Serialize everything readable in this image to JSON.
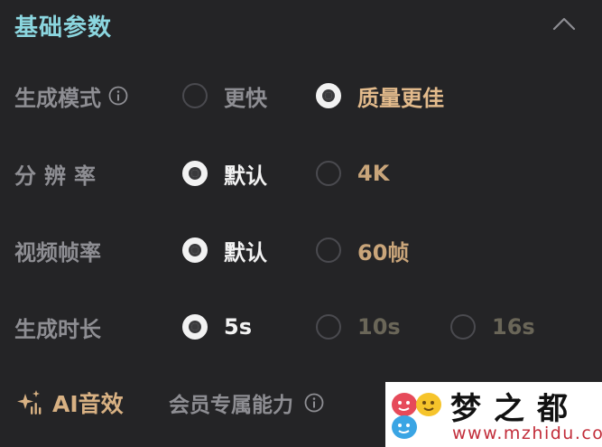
{
  "section": {
    "title": "基础参数",
    "collapse_icon": "chevron-up-icon"
  },
  "rows": [
    {
      "label": "生成模式",
      "info_icon": "info-icon",
      "options": [
        {
          "label": "更快",
          "selected": false
        },
        {
          "label": "质量更佳",
          "selected": true
        }
      ]
    },
    {
      "label": "分辨率",
      "options": [
        {
          "label": "默认",
          "selected": true
        },
        {
          "label": "4K",
          "selected": false
        }
      ]
    },
    {
      "label": "视频帧率",
      "options": [
        {
          "label": "默认",
          "selected": true
        },
        {
          "label": "60帧",
          "selected": false
        }
      ]
    },
    {
      "label": "生成时长",
      "options": [
        {
          "label": "5s",
          "selected": true
        },
        {
          "label": "10s",
          "selected": false
        },
        {
          "label": "16s",
          "selected": false
        }
      ]
    }
  ],
  "footer": {
    "ai_icon": "sparkle-music-icon",
    "ai_label": "AI音效",
    "member_label": "会员专属能力",
    "info_icon": "info-icon"
  },
  "watermark": {
    "title": "梦之都",
    "url": "www.mzhidu.com"
  },
  "colors": {
    "background": "#242426",
    "title_accent": "#8bd6df",
    "gold": "#c9a57a",
    "label_gray": "#8e8e93",
    "selected_text": "#f2f2f2"
  }
}
